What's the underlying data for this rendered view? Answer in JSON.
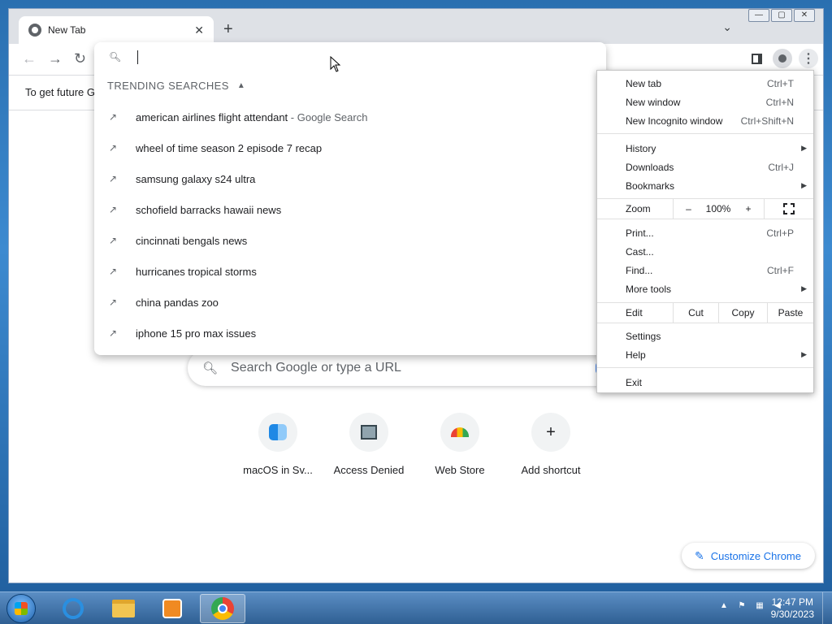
{
  "browser": {
    "tab_title": "New Tab",
    "tab_close": "✕",
    "new_tab_symbol": "+",
    "tab_search_symbol": "⌄",
    "window_controls": [
      "—",
      "▢",
      "✕"
    ],
    "nav": {
      "back": "←",
      "forward": "→",
      "reload": "↻"
    },
    "infobar_text": "To get future G"
  },
  "omnibox": {
    "heading": "TRENDING SEARCHES",
    "suggestions": [
      {
        "text": "american airlines flight attendant",
        "suffix": " - Google Search"
      },
      {
        "text": "wheel of time season 2 episode 7 recap",
        "suffix": ""
      },
      {
        "text": "samsung galaxy s24 ultra",
        "suffix": ""
      },
      {
        "text": "schofield barracks hawaii news",
        "suffix": ""
      },
      {
        "text": "cincinnati bengals news",
        "suffix": ""
      },
      {
        "text": "hurricanes tropical storms",
        "suffix": ""
      },
      {
        "text": "china pandas zoo",
        "suffix": ""
      },
      {
        "text": "iphone 15 pro max issues",
        "suffix": ""
      }
    ]
  },
  "ntp": {
    "search_placeholder": "Search Google or type a URL",
    "shortcuts": [
      {
        "label": "macOS in Sv...",
        "icon": "finder-icon"
      },
      {
        "label": "Access Denied",
        "icon": "computer-icon"
      },
      {
        "label": "Web Store",
        "icon": "web-store-icon"
      },
      {
        "label": "Add shortcut",
        "icon": "plus-icon"
      }
    ],
    "add_symbol": "+",
    "customize_label": "Customize Chrome"
  },
  "menu": {
    "new_tab": "New tab",
    "new_tab_key": "Ctrl+T",
    "new_window": "New window",
    "new_window_key": "Ctrl+N",
    "incognito": "New Incognito window",
    "incognito_key": "Ctrl+Shift+N",
    "history": "History",
    "downloads": "Downloads",
    "downloads_key": "Ctrl+J",
    "bookmarks": "Bookmarks",
    "zoom_label": "Zoom",
    "zoom_minus": "–",
    "zoom_value": "100%",
    "zoom_plus": "+",
    "print": "Print...",
    "print_key": "Ctrl+P",
    "cast": "Cast...",
    "find": "Find...",
    "find_key": "Ctrl+F",
    "more_tools": "More tools",
    "edit_label": "Edit",
    "cut": "Cut",
    "copy": "Copy",
    "paste": "Paste",
    "settings": "Settings",
    "help": "Help",
    "exit": "Exit"
  },
  "taskbar": {
    "time": "12:47 PM",
    "date": "9/30/2023",
    "tray_up": "▲"
  }
}
